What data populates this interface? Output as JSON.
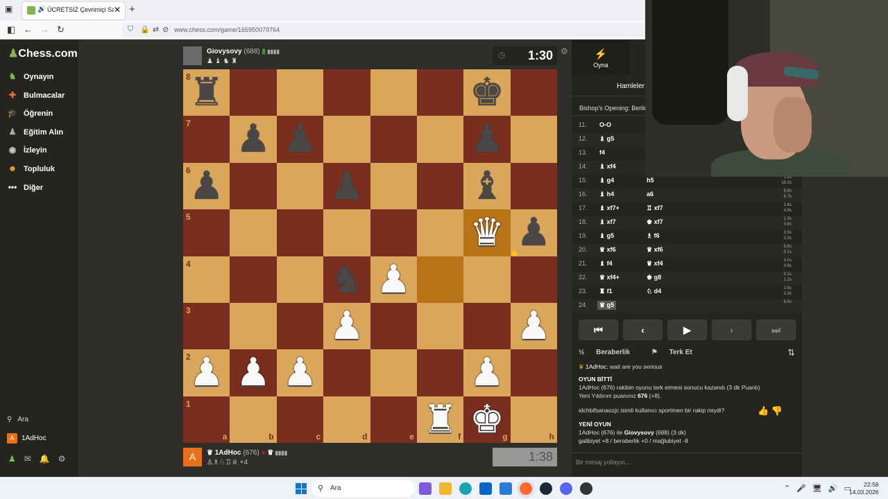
{
  "browser": {
    "tab_title": "ÜCRETSİZ Çevrimiçi Satranç",
    "tab_close": "✕",
    "new_tab": "+",
    "url": "www.chess.com/game/165950079764"
  },
  "sidebar": {
    "logo": "Chess.com",
    "items": [
      {
        "label": "Oynayın",
        "icon": "play-icon"
      },
      {
        "label": "Bulmacalar",
        "icon": "puzzle-icon"
      },
      {
        "label": "Öğrenin",
        "icon": "learn-icon"
      },
      {
        "label": "Eğitim Alın",
        "icon": "coach-icon"
      },
      {
        "label": "İzleyin",
        "icon": "watch-icon"
      },
      {
        "label": "Topluluk",
        "icon": "community-icon"
      },
      {
        "label": "Diğer",
        "icon": "more-icon"
      }
    ],
    "search_label": "Ara",
    "user_label": "1AdHoc",
    "avatar_letter": "A"
  },
  "top_player": {
    "name": "Giovysovy",
    "rating": "(688)",
    "captured": "♟ ♝ ♞ ♜",
    "clock": "1:30"
  },
  "bottom_player": {
    "name": "1AdHoc",
    "rating": "(676)",
    "avatar_letter": "A",
    "captured": "♙♗♘♖♕",
    "advantage": "+4",
    "clock": "1:38"
  },
  "board": {
    "ranks": [
      "8",
      "7",
      "6",
      "5",
      "4",
      "3",
      "2",
      "1"
    ],
    "files": [
      "a",
      "b",
      "c",
      "d",
      "e",
      "f",
      "g",
      "h"
    ],
    "position": [
      [
        "bR",
        "",
        "",
        "",
        "",
        "",
        "bK",
        ""
      ],
      [
        "",
        "bP",
        "bP",
        "",
        "",
        "",
        "bP",
        ""
      ],
      [
        "bP",
        "",
        "",
        "bP",
        "",
        "",
        "bB",
        ""
      ],
      [
        "",
        "",
        "",
        "",
        "",
        "",
        "wQ",
        "bP"
      ],
      [
        "",
        "",
        "",
        "bN",
        "wP",
        "",
        "",
        ""
      ],
      [
        "",
        "",
        "",
        "wP",
        "",
        "",
        "",
        "wP"
      ],
      [
        "wP",
        "wP",
        "wP",
        "",
        "",
        "",
        "wP",
        ""
      ],
      [
        "",
        "",
        "",
        "",
        "",
        "wR",
        "wK",
        ""
      ]
    ],
    "highlight": [
      "f4",
      "g5"
    ]
  },
  "panel": {
    "tab_play": "Oyna",
    "subtab": "Hamleler",
    "opening": "Bishop's Opening: Berlin,",
    "moves": [
      {
        "n": "11.",
        "w": "O-O",
        "b": "",
        "tw": "",
        "tb": ""
      },
      {
        "n": "12.",
        "w": "♝ g5",
        "b": "",
        "tw": "",
        "tb": ""
      },
      {
        "n": "13.",
        "w": "f4",
        "b": "",
        "tw": "",
        "tb": ""
      },
      {
        "n": "14.",
        "w": "♝ xf4",
        "b": "",
        "tw": "",
        "tb": ""
      },
      {
        "n": "15.",
        "w": "♝ g4",
        "b": "h5",
        "tw": "1.6s",
        "tb": "18.3s"
      },
      {
        "n": "16.",
        "w": "♝ h4",
        "b": "a6",
        "tw": "8.9s",
        "tb": "6.7s"
      },
      {
        "n": "17.",
        "w": "♝ xf7+",
        "b": "♖ xf7",
        "tw": "2.6s",
        "tb": "4.9s"
      },
      {
        "n": "18.",
        "w": "♝ xf7",
        "b": "♚ xf7",
        "tw": "1.3s",
        "tb": "0.8s"
      },
      {
        "n": "19.",
        "w": "♝ g5",
        "b": "♗ f6",
        "tw": "3.9s",
        "tb": "2.3s"
      },
      {
        "n": "20.",
        "w": "♛ xf6",
        "b": "♛ xf6",
        "tw": "5.6s",
        "tb": "0.1s"
      },
      {
        "n": "21.",
        "w": "♝ f4",
        "b": "♛ xf4",
        "tw": "3.0s",
        "tb": "4.9s"
      },
      {
        "n": "22.",
        "w": "♛ xf4+",
        "b": "♚ g8",
        "tw": "0.1s",
        "tb": "1.2s"
      },
      {
        "n": "23.",
        "w": "♜ f1",
        "b": "♘ d4",
        "tw": "2.6s",
        "tb": "3.3s"
      },
      {
        "n": "24.",
        "w": "♛ g5",
        "b": "",
        "tw": "6.8s",
        "tb": ""
      }
    ],
    "controls": [
      "⏮",
      "‹",
      "▶",
      "›",
      "⏭"
    ],
    "draw_label": "Beraberlik",
    "draw_icon": "½",
    "resign_label": "Terk Et",
    "chat": {
      "line1_user": "1AdHoc:",
      "line1_text": "wait are you serious",
      "over_head": "OYUN BİTTİ",
      "over_line1": "1AdHoc (676) rakibin oyunu terk etmesi sonucu kazandı (3 dk Puanlı)",
      "over_line2_pre": "Yeni Yıldırım puanınız",
      "over_line2_val": "676",
      "over_line2_post": "(+8).",
      "sportsman": "idchbifsanaozjc isimli kullanıcı sportmen bir rakip miydi?",
      "new_head": "YENİ OYUN",
      "new_line1_pre": "1AdHoc (676) ile",
      "new_line1_name": "Giovysovy",
      "new_line1_post": "(688) (3 dk)",
      "new_line2": "galibiyet +8 / beraberlik +0 / mağlubiyet -8"
    },
    "chat_placeholder": "Bir mesaj yollayın..."
  },
  "taskbar": {
    "search": "Ara",
    "time": "22:58",
    "date": "14.03.2026"
  }
}
